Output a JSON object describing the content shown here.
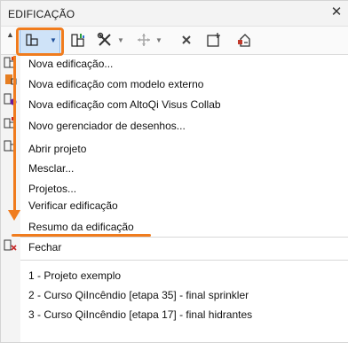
{
  "window": {
    "title": "EDIFICAÇÃO",
    "close_glyph": "✕"
  },
  "toolbar": {
    "buttons": [
      {
        "icon": "building-icon"
      },
      {
        "icon": "building-stats-icon"
      },
      {
        "icon": "tools-icon"
      },
      {
        "icon": "move-icon"
      },
      {
        "icon": "delete-icon"
      },
      {
        "icon": "new-window-icon"
      },
      {
        "icon": "add-floor-icon"
      }
    ]
  },
  "menu": {
    "items": [
      "Nova edificação...",
      "Nova edificação com modelo externo",
      "Nova edificação com AltoQi Visus Collab",
      "Novo gerenciador de desenhos...",
      "Abrir projeto",
      "Mesclar...",
      "Projetos...",
      "Verificar edificação",
      "Resumo da edificação",
      "Fechar",
      "1 - Projeto exemplo",
      "2 - Curso QiIncêndio [etapa 35] - final sprinkler",
      "3 - Curso QiIncêndio [etapa 17] - final hidrantes"
    ]
  },
  "highlight_color": "#f07c1e"
}
